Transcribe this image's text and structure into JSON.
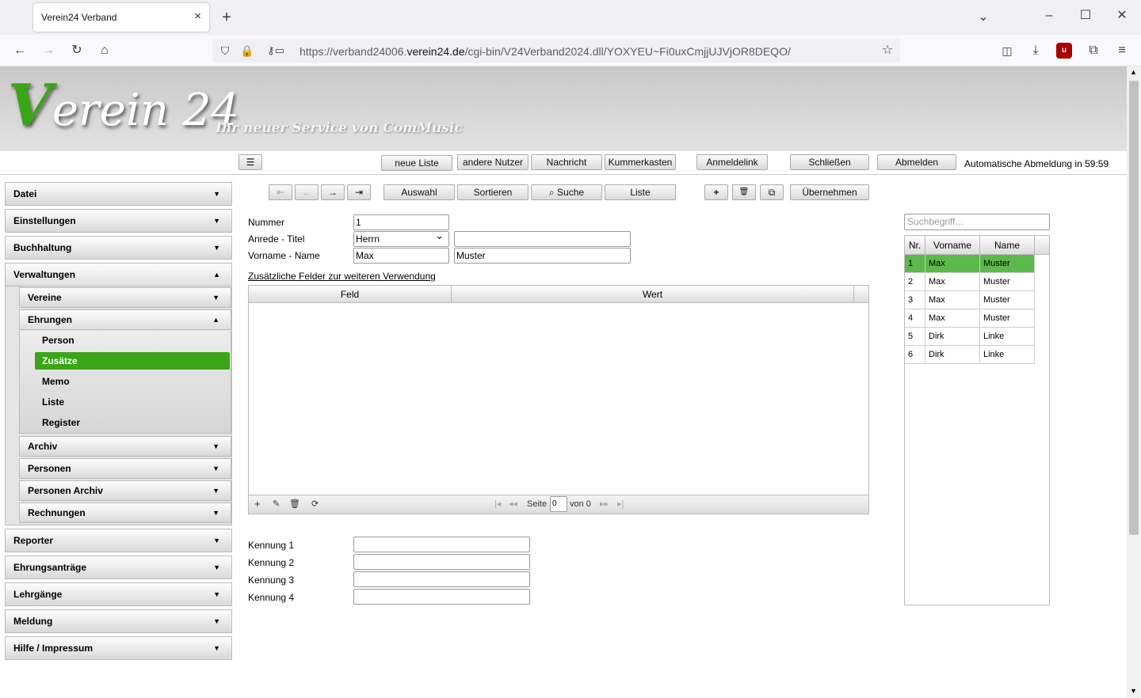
{
  "browser": {
    "tab_title": "Verein24 Verband",
    "tab_close": "×",
    "new_tab": "+",
    "url_prefix": "https://verband24006.",
    "url_domain": "verein24.de",
    "url_path": "/cgi-bin/V24Verband2024.dll/YOXYEU~Fi0uxCmjjUJVjOR8DEQO/"
  },
  "header": {
    "logo_v": "V",
    "logo_rest": "erein 24",
    "slogan": "Ihr neuer Service von ComMusic"
  },
  "topbar": {
    "menu_icon": "☰",
    "buttons": [
      "neue Liste",
      "andere Nutzer",
      "Nachricht",
      "Kummerkasten",
      "Anmeldelink",
      "Schließen",
      "Abmelden"
    ],
    "autologout": "Automatische Abmeldung in 59:59"
  },
  "sidebar": {
    "datei": "Datei",
    "einstellungen": "Einstellungen",
    "buchhaltung": "Buchhaltung",
    "verwaltungen": "Verwaltungen",
    "vereine": "Vereine",
    "ehrungen": "Ehrungen",
    "leaves": [
      "Person",
      "Zusätze",
      "Memo",
      "Liste",
      "Register"
    ],
    "archiv": "Archiv",
    "personen": "Personen",
    "personen_archiv": "Personen Archiv",
    "rechnungen": "Rechnungen",
    "reporter": "Reporter",
    "ehrungsantraege": "Ehrungsanträge",
    "lehrgaenge": "Lehrgänge",
    "meldung": "Meldung",
    "hilfe": "Hilfe / Impressum"
  },
  "toolbar": {
    "first": "⇤",
    "prev": "←",
    "next": "→",
    "last": "⇥",
    "auswahl": "Auswahl",
    "sortieren": "Sortieren",
    "suche": "Suche",
    "liste": "Liste",
    "add": "+",
    "delete": "🗑",
    "copy": "⧉",
    "uebernehmen": "Übernehmen"
  },
  "form": {
    "nummer_label": "Nummer",
    "nummer": "1",
    "anrede_label": "Anrede - Titel",
    "anrede": "Herrn",
    "titel": "",
    "name_label": "Vorname - Name",
    "vorname": "Max",
    "name": "Muster",
    "zusatz_link": "Zusätzliche Felder zur weiteren Verwendung",
    "grid_cols": [
      "Feld",
      "Wert"
    ],
    "grid_footer": {
      "seite": "Seite",
      "page": "0",
      "von": "von 0"
    },
    "kennung_labels": [
      "Kennung 1",
      "Kennung 2",
      "Kennung 3",
      "Kennung 4"
    ],
    "kennung_values": [
      "",
      "",
      "",
      ""
    ]
  },
  "rightlist": {
    "search_placeholder": "Suchbegriff...",
    "columns": [
      "Nr.",
      "Vorname",
      "Name"
    ],
    "rows": [
      {
        "nr": "1",
        "vorname": "Max",
        "name": "Muster"
      },
      {
        "nr": "2",
        "vorname": "Max",
        "name": "Muster"
      },
      {
        "nr": "3",
        "vorname": "Max",
        "name": "Muster"
      },
      {
        "nr": "4",
        "vorname": "Max",
        "name": "Muster"
      },
      {
        "nr": "5",
        "vorname": "Dirk",
        "name": "Linke"
      },
      {
        "nr": "6",
        "vorname": "Dirk",
        "name": "Linke"
      }
    ],
    "selected_color": "#5bb84a"
  },
  "colors": {
    "accent": "#3aa517"
  }
}
